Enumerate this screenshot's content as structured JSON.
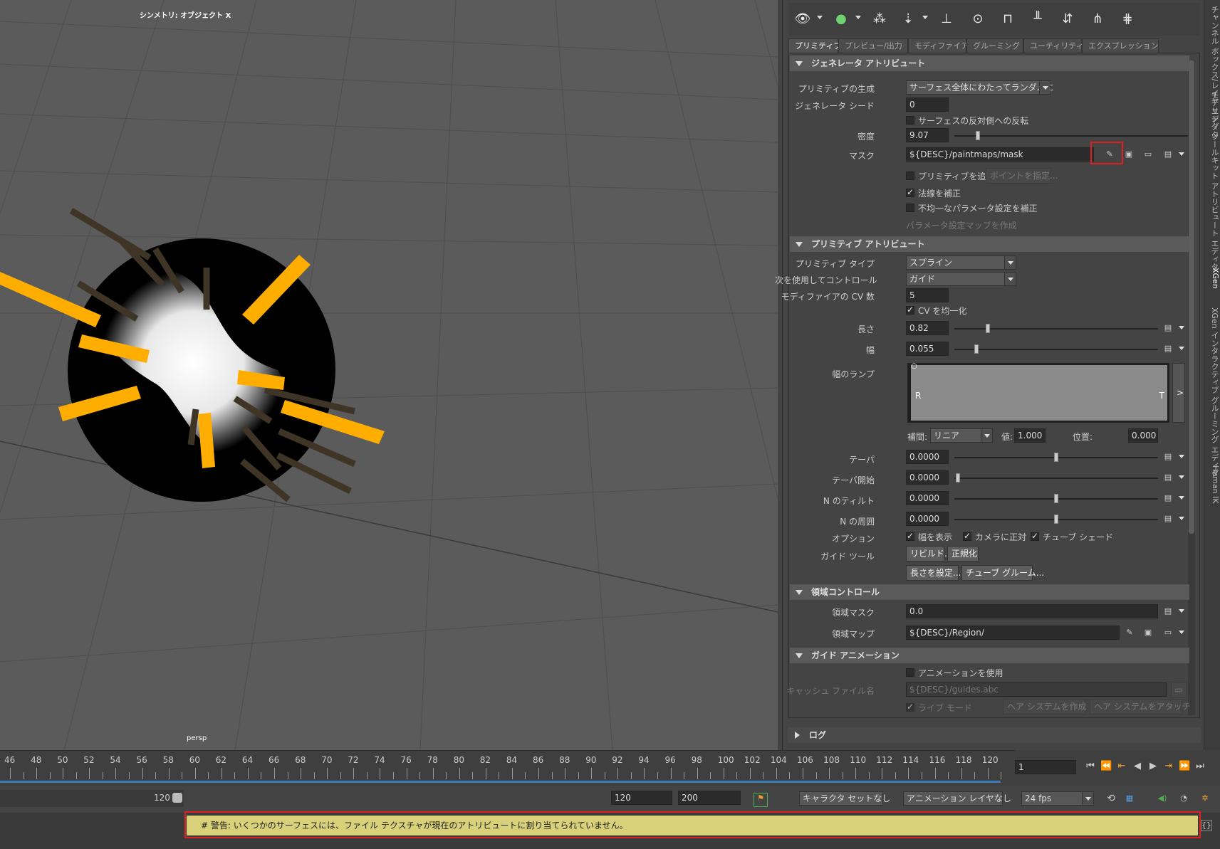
{
  "viewport": {
    "symmetry_label": "シンメトリ: オブジェクト X",
    "camera_label": "persp"
  },
  "toolbar": {
    "icons": [
      "visibility-eye-icon",
      "display-leaf-icon",
      "add-guides-icon",
      "sculpt-guides-icon",
      "add-guide-icon",
      "show-guides-icon",
      "lock-guides-icon",
      "cut-guides-icon",
      "flip-guides-icon",
      "guide-cv-icon",
      "bend-guides-icon"
    ]
  },
  "tabs": [
    "プリミティブ",
    "プレビュー/出力",
    "モディファイア",
    "グルーミング",
    "ユーティリティ",
    "エクスプレッション"
  ],
  "generator": {
    "title": "ジェネレータ アトリビュート",
    "primitive_gen_label": "プリミティブの生成",
    "primitive_gen_value": "サーフェス全体にわたってランダムに",
    "seed_label": "ジェネレータ シード",
    "seed_value": "0",
    "flip_label": "サーフェスの反対側への反転",
    "density_label": "密度",
    "density_value": "9.07",
    "mask_label": "マスク",
    "mask_value": "${DESC}/paintmaps/mask",
    "add_primitive_label": "プリミティブを追加",
    "point_button": "ポイントを指定...",
    "normal_label": "法線を補正",
    "nonuniform_label": "不均一なパラメータ設定を補正",
    "param_map_button": "パラメータ設定マップを作成"
  },
  "primitive": {
    "title": "プリミティブ アトリビュート",
    "type_label": "プリミティブ タイプ",
    "type_value": "スプライン",
    "control_label": "次を使用してコントロール",
    "control_value": "ガイド",
    "cv_label": "モディファイアの CV 数",
    "cv_value": "5",
    "cv_uniform_label": "CV を均一化",
    "length_label": "長さ",
    "length_value": "0.82",
    "width_label": "幅",
    "width_value": "0.055",
    "ramp_label": "幅のランプ",
    "ramp_left": "R",
    "ramp_right": "T",
    "interp_label": "補間:",
    "interp_value": "リニア",
    "val_label": "値:",
    "val_value": "1.000",
    "pos_label": "位置:",
    "pos_value": "0.000",
    "taper_label": "テーパ",
    "taper_value": "0.0000",
    "taper_start_label": "テーパ開始",
    "taper_start_value": "0.0000",
    "n_tilt_label": "N のティルト",
    "n_tilt_value": "0.0000",
    "n_twist_label": "N の周囲",
    "n_twist_value": "0.0000",
    "options_label": "オプション",
    "opt_width": "幅を表示",
    "opt_camera": "カメラに正対",
    "opt_tube": "チューブ シェード",
    "guide_tool_label": "ガイド ツール",
    "rebuild_button": "リビルド...",
    "normalize_button": "正規化",
    "set_length_button": "長さを設定...",
    "tube_groom_button": "チューブ グルーム..."
  },
  "region": {
    "title": "領域コントロール",
    "mask_label": "領域マスク",
    "mask_value": "0.0",
    "map_label": "領域マップ",
    "map_value": "${DESC}/Region/"
  },
  "guide_anim": {
    "title": "ガイド アニメーション",
    "use_anim_label": "アニメーションを使用",
    "cache_label": "キャッシュ ファイル名",
    "cache_value": "${DESC}/guides.abc",
    "live_label": "ライブ モード",
    "create_hair_button": "ヘア システムを作成",
    "attach_hair_button": "ヘア システムをアタッチ"
  },
  "log": {
    "title": "ログ"
  },
  "side_tabs": [
    "チャンネル ボックス/レイヤ エディタ",
    "モデリング ツールキット",
    "アトリビュート エディタ",
    "XGen",
    "XGen インタラクティブ グルーミング エディタ",
    "Human IK"
  ],
  "timeline": {
    "ticks": [
      "46",
      "48",
      "50",
      "52",
      "54",
      "56",
      "58",
      "60",
      "62",
      "64",
      "66",
      "68",
      "70",
      "72",
      "74",
      "76",
      "78",
      "80",
      "82",
      "84",
      "86",
      "88",
      "90",
      "92",
      "94",
      "96",
      "98",
      "100",
      "102",
      "104",
      "106",
      "108",
      "110",
      "112",
      "114",
      "116",
      "118",
      "120"
    ],
    "current_frame": "1"
  },
  "range": {
    "range_end_slider": "120",
    "anim_end": "120",
    "playback_end": "200",
    "character_set": "キャラクタ セットなし",
    "anim_layer": "アニメーション レイヤなし",
    "fps": "24 fps"
  },
  "status": {
    "warning": "# 警告: いくつかのサーフェスには、ファイル テクスチャが現在のアトリビュートに割り当てられていません。"
  }
}
